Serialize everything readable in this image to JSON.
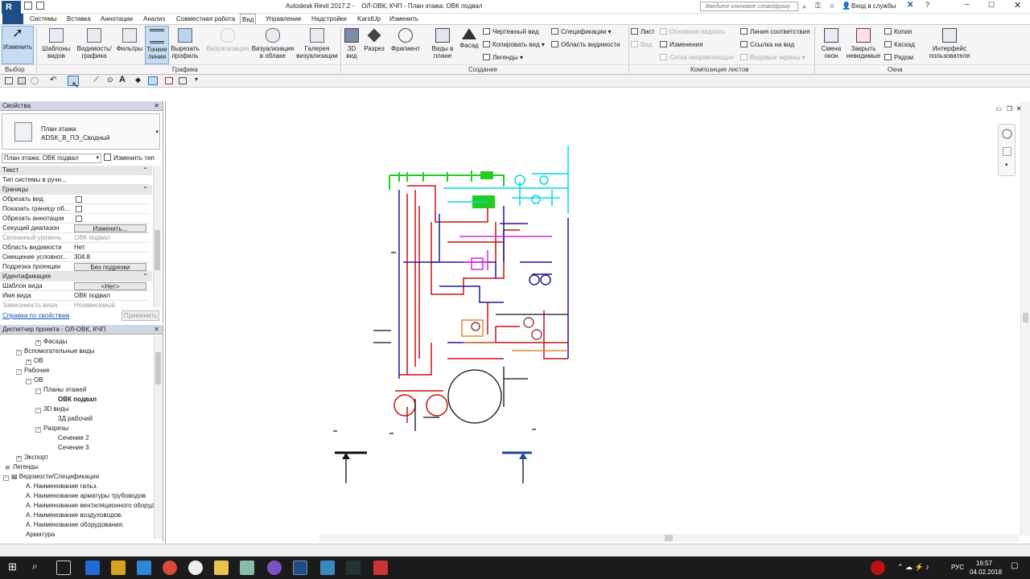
{
  "app": {
    "title": "Autodesk Revit 2017.2 -    ОЛ-ОВК, КЧП - План этажа: ОВК подвал",
    "search_placeholder": "Введите ключевое слово/фразу",
    "signin": "Вход в службы",
    "logo": "R"
  },
  "tabs": [
    "Системы",
    "Вставка",
    "Аннотации",
    "Анализ",
    "Совместная работа",
    "Вид",
    "Управление",
    "Надстройки",
    "KarstUp",
    "Изменить"
  ],
  "ribbon": {
    "modify": "Изменить",
    "templates": "Шаблоны видов",
    "vg": "Видимость/ графика",
    "filters": "Фильтры",
    "thin": "Тонкие линии",
    "cut": "Вырезать профиль",
    "render": "Визуализация",
    "render_cloud": "Визуализация в облаке",
    "gallery": "Галерея визуализации",
    "v3d": "3D вид",
    "section": "Разрез",
    "callout": "Фрагмент",
    "plan": "Виды в плане",
    "elev": "Фасад",
    "drafting": "Чертежный вид",
    "duplicate": "Копировать вид",
    "legends": "Легенды",
    "schedules": "Спецификации",
    "scope": "Область видимости",
    "sheet": "Лист",
    "view": "Вид",
    "titleblock": "Основная надпись",
    "revisions": "Изменения",
    "guide": "Сетка направляющих",
    "matchline": "Линия соответствия",
    "viewref": "Ссылка на вид",
    "viewports": "Видовые экраны",
    "switch": "Смена окон",
    "close": "Закрыть невидимые",
    "copy": "Копия",
    "cascade": "Каскад",
    "tile": "Рядом",
    "ui": "Интерфейс пользователя"
  },
  "panels": {
    "select": "Выбор",
    "graphics": "Графика",
    "create": "Создание",
    "sheets": "Композиция листов",
    "windows": "Окна"
  },
  "properties": {
    "title": "Свойства",
    "type1": "План этажа",
    "type2": "ADSK_В_ПЭ_Сводный",
    "selector": "План этажа: ОВК подвал",
    "edit_type": "Изменить тип",
    "groups": {
      "text": "Текст",
      "bounds": "Границы",
      "ident": "Идентификация"
    },
    "rows": {
      "sys_type": "Тип системы в ручн...",
      "crop": "Обрезать вид",
      "show_crop": "Показать границу об...",
      "crop_ann": "Обрезать аннотации",
      "range": "Секущий диапазон",
      "range_btn": "Изменить...",
      "assoc": "Связанный уровень",
      "assoc_v": "ОВК подвал",
      "scopebox": "Область видимости",
      "scopebox_v": "Нет",
      "offset": "Смещение условног...",
      "offset_v": "304.8",
      "depth": "Подрезка проекции",
      "depth_btn": "Без подрезки",
      "tmpl": "Шаблон вида",
      "tmpl_btn": "<Нет>",
      "name": "Имя вида",
      "name_v": "ОВК подвал",
      "dep": "Зависимость вида",
      "dep_v": "Независимый"
    },
    "help": "Справка по свойствам",
    "apply": "Применить"
  },
  "browser": {
    "title": "Диспетчер проекта - ОЛ-ОВК, КЧП",
    "items": [
      "Фасады",
      "Вспомогательные виды",
      "ОВ",
      "Рабочие",
      "ОВ",
      "Планы этажей",
      "ОВК подвал",
      "3D виды",
      "3Д рабочий",
      "Разрезы",
      "Сечение 2",
      "Сечение 3",
      "Экспорт",
      "Легенды",
      "Ведомости/Спецификации",
      "А. Наименование гильз.",
      "А. Наименование арматуры трубоводов",
      "А. Наименование вентиляционного оборудования",
      "А. Наименование воздуховодов.",
      "А. Наименование оборудования.",
      "Арматура"
    ]
  },
  "taskbar": {
    "lang": "РУС",
    "time": "16:57",
    "date": "04.02.2018"
  },
  "colors": {
    "accent": "#1a4d8f",
    "ribbon_active": "#c5dcf3"
  }
}
